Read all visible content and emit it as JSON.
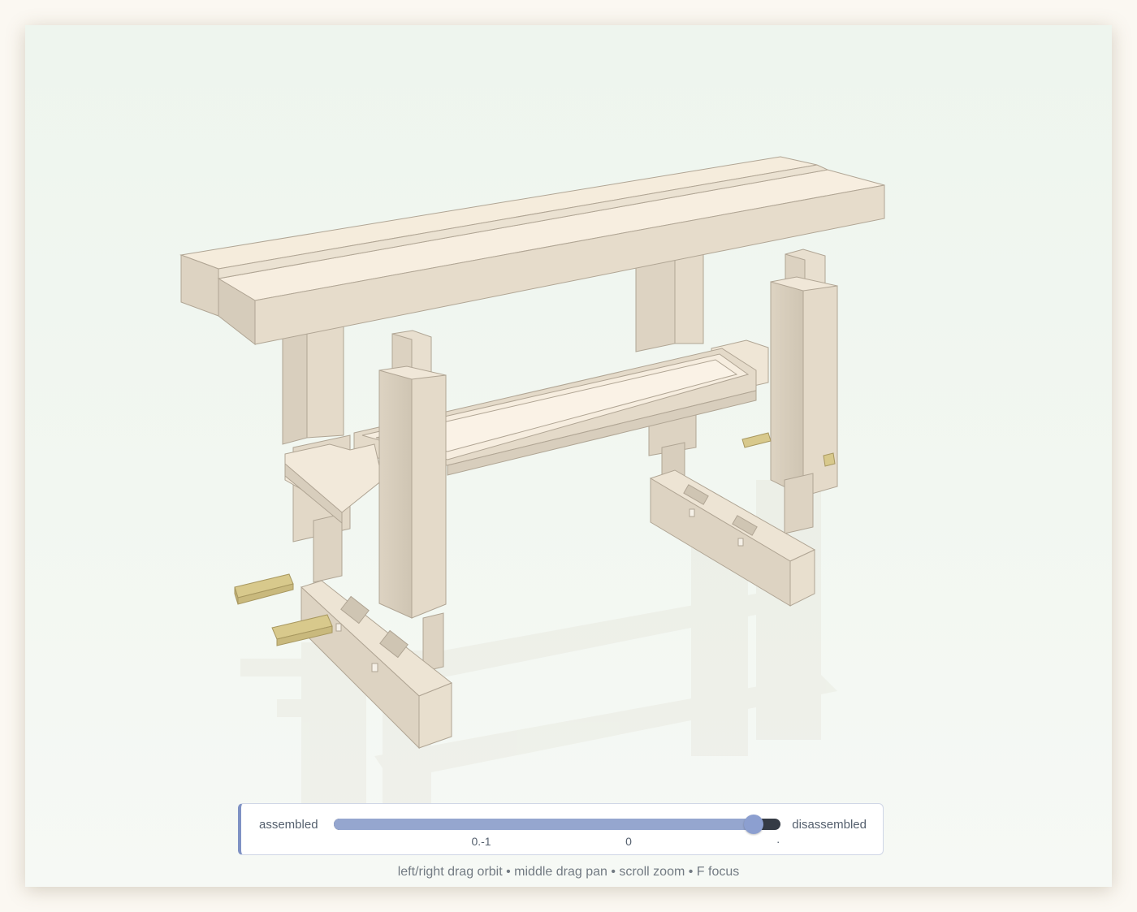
{
  "slider": {
    "left_label": "assembled",
    "right_label": "disassembled",
    "value": 0.94,
    "ticks": [
      {
        "text": "0.-1",
        "value": 0.33
      },
      {
        "text": "0",
        "value": 0.66
      },
      {
        "text": "·",
        "value": 0.995
      }
    ]
  },
  "hint": "left/right drag orbit • middle drag pan • scroll zoom • F focus",
  "colors": {
    "wood_top": "#f5ecdc",
    "wood_side": "#e3d9c8",
    "wood_edge": "#b0a594",
    "peg": "#d8c98c",
    "slider_fill": "#95a6cf",
    "slider_track": "#353b45",
    "panel_border": "#7f92c4"
  }
}
